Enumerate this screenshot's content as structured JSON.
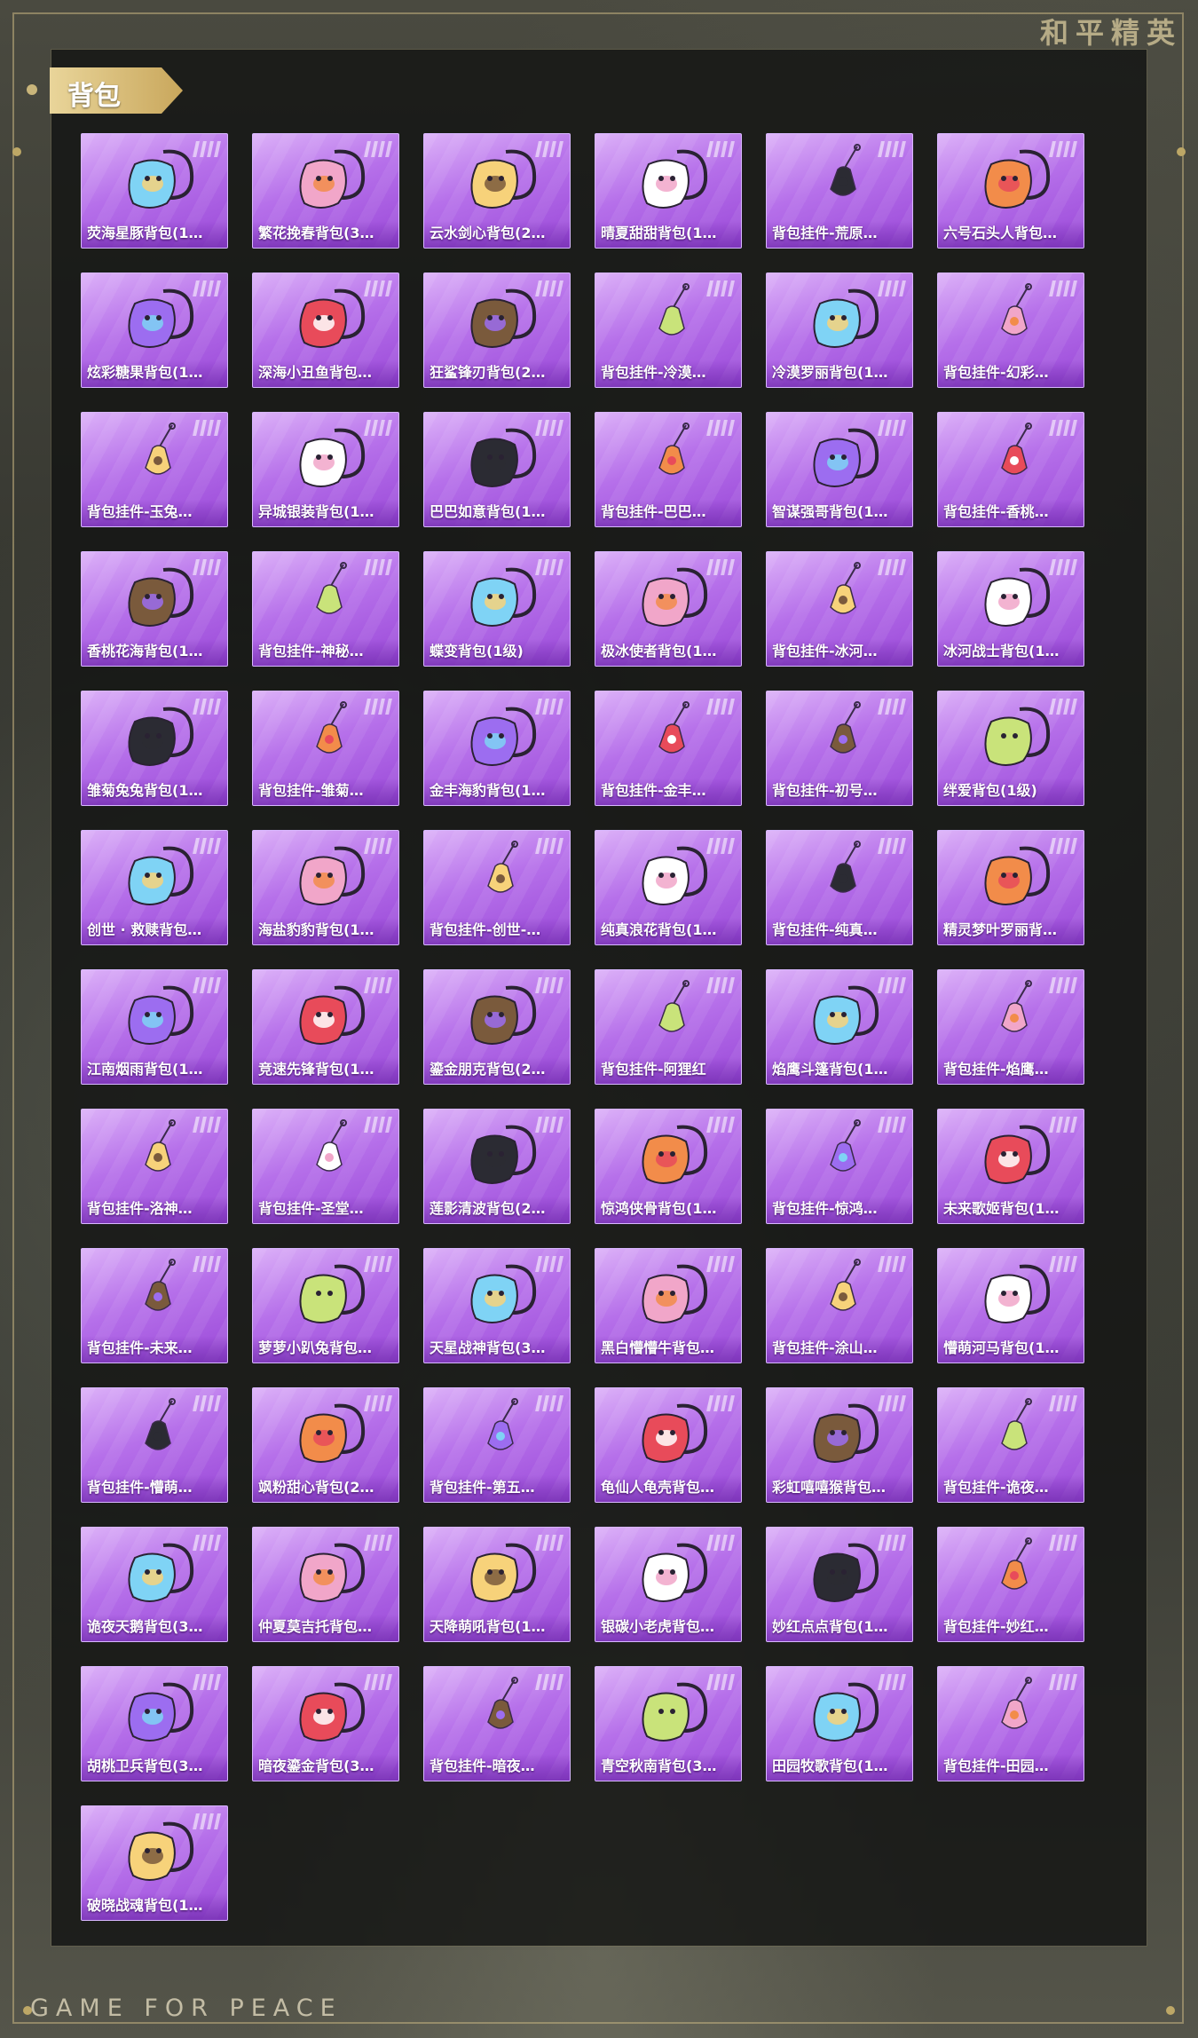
{
  "brand": "和平精英",
  "section_title": "背包",
  "footer": "GAME FOR PEACE",
  "colors": {
    "card_top": "#dcb1f8",
    "card_bottom": "#9a49d8",
    "card_border": "#d8b7ff",
    "tag_gold": "#e9d59a"
  },
  "items": [
    {
      "name": "荧海星豚背包(1…",
      "icon": "dolphin-backpack"
    },
    {
      "name": "繁花挽春背包(3…",
      "icon": "flower-bowl-backpack"
    },
    {
      "name": "云水剑心背包(2…",
      "icon": "sword-backpack"
    },
    {
      "name": "晴夏甜甜背包(1…",
      "icon": "bunny-backpack"
    },
    {
      "name": "背包挂件-荒原…",
      "icon": "star-charm"
    },
    {
      "name": "六号石头人背包…",
      "icon": "stone-golem-backpack"
    },
    {
      "name": "炫彩糖果背包(1…",
      "icon": "donut-backpack"
    },
    {
      "name": "深海小丑鱼背包…",
      "icon": "clownfish-backpack"
    },
    {
      "name": "狂鲨锋刃背包(2…",
      "icon": "shark-backpack"
    },
    {
      "name": "背包挂件-冷漠…",
      "icon": "flower-charm"
    },
    {
      "name": "冷漠罗丽背包(1…",
      "icon": "crown-backpack"
    },
    {
      "name": "背包挂件-幻彩…",
      "icon": "robot-charm"
    },
    {
      "name": "背包挂件-玉兔…",
      "icon": "rabbit-charm"
    },
    {
      "name": "异城银装背包(1…",
      "icon": "tech-backpack"
    },
    {
      "name": "巴巴如意背包(1…",
      "icon": "white-bunny-backpack"
    },
    {
      "name": "背包挂件-巴巴…",
      "icon": "fox-charm"
    },
    {
      "name": "智谋强哥背包(1…",
      "icon": "bear-backpack"
    },
    {
      "name": "背包挂件-香桃…",
      "icon": "peach-blossom-charm"
    },
    {
      "name": "香桃花海背包(1…",
      "icon": "shell-backpack"
    },
    {
      "name": "背包挂件-神秘…",
      "icon": "black-cat-charm"
    },
    {
      "name": "蝶变背包(1级)",
      "icon": "butterfly-backpack"
    },
    {
      "name": "极冰使者背包(1…",
      "icon": "ice-backpack"
    },
    {
      "name": "背包挂件-冰河…",
      "icon": "mech-charm"
    },
    {
      "name": "冰河战士背包(1…",
      "icon": "blue-backpack"
    },
    {
      "name": "雏菊兔兔背包(1…",
      "icon": "daisy-backpack"
    },
    {
      "name": "背包挂件-雏菊…",
      "icon": "bunny-plush-charm"
    },
    {
      "name": "金丰海豹背包(1…",
      "icon": "seal-backpack"
    },
    {
      "name": "背包挂件-金丰…",
      "icon": "banner-charm"
    },
    {
      "name": "背包挂件-初号…",
      "icon": "purple-sword-charm"
    },
    {
      "name": "绊爱背包(1级)",
      "icon": "pink-backpack"
    },
    {
      "name": "创世 · 救赎背包…",
      "icon": "gold-mech-backpack"
    },
    {
      "name": "海盐豹豹背包(1…",
      "icon": "blob-backpack"
    },
    {
      "name": "背包挂件-创世-…",
      "icon": "canister-charm"
    },
    {
      "name": "纯真浪花背包(1…",
      "icon": "bucket-backpack"
    },
    {
      "name": "背包挂件-纯真…",
      "icon": "key-charm"
    },
    {
      "name": "精灵梦叶罗丽背…",
      "icon": "lace-backpack"
    },
    {
      "name": "江南烟雨背包(1…",
      "icon": "fan-backpack"
    },
    {
      "name": "竞速先锋背包(1…",
      "icon": "racer-backpack"
    },
    {
      "name": "鎏金朋克背包(2…",
      "icon": "punk-backpack"
    },
    {
      "name": "背包挂件-阿狸红",
      "icon": "red-fox-charm"
    },
    {
      "name": "焰鹰斗篷背包(1…",
      "icon": "cape-backpack"
    },
    {
      "name": "背包挂件-焰鹰…",
      "icon": "knot-charm"
    },
    {
      "name": "背包挂件-洛神…",
      "icon": "ribbon-charm"
    },
    {
      "name": "背包挂件-圣堂…",
      "icon": "gem-charm"
    },
    {
      "name": "莲影清波背包(2…",
      "icon": "lotus-backpack"
    },
    {
      "name": "惊鸿侠骨背包(1…",
      "icon": "leather-backpack"
    },
    {
      "name": "背包挂件-惊鸿…",
      "icon": "tassel-charm"
    },
    {
      "name": "未来歌姬背包(1…",
      "icon": "idol-backpack"
    },
    {
      "name": "背包挂件-未来…",
      "icon": "heart-wing-charm"
    },
    {
      "name": "萝萝小趴兔背包…",
      "icon": "yellow-bunny-backpack"
    },
    {
      "name": "天星战神背包(3…",
      "icon": "winged-backpack"
    },
    {
      "name": "黑白懵懵牛背包…",
      "icon": "cow-backpack"
    },
    {
      "name": "背包挂件-涂山…",
      "icon": "fox-tail-charm"
    },
    {
      "name": "懵萌河马背包(1…",
      "icon": "hippo-backpack"
    },
    {
      "name": "背包挂件-懵萌…",
      "icon": "leaf-charm"
    },
    {
      "name": "飒粉甜心背包(2…",
      "icon": "pink-cat-backpack"
    },
    {
      "name": "背包挂件-第五…",
      "icon": "pink-heart-charm"
    },
    {
      "name": "龟仙人龟壳背包…",
      "icon": "turtle-shell-backpack"
    },
    {
      "name": "彩虹嘻嘻猴背包…",
      "icon": "monkey-backpack"
    },
    {
      "name": "背包挂件-诡夜…",
      "icon": "doll-charm"
    },
    {
      "name": "诡夜天鹅背包(3…",
      "icon": "ghost-backpack"
    },
    {
      "name": "仲夏莫吉托背包…",
      "icon": "cup-backpack"
    },
    {
      "name": "天降萌吼背包(1…",
      "icon": "orange-backpack"
    },
    {
      "name": "银碳小老虎背包…",
      "icon": "tiger-backpack"
    },
    {
      "name": "妙红点点背包(1…",
      "icon": "red-bottle-backpack"
    },
    {
      "name": "背包挂件-妙红…",
      "icon": "daisy-charm"
    },
    {
      "name": "胡桃卫兵背包(3…",
      "icon": "guard-backpack"
    },
    {
      "name": "暗夜鎏金背包(3…",
      "icon": "dark-gold-backpack"
    },
    {
      "name": "背包挂件-暗夜…",
      "icon": "dark-tassel-charm"
    },
    {
      "name": "青空秋南背包(3…",
      "icon": "navy-backpack"
    },
    {
      "name": "田园牧歌背包(1…",
      "icon": "basket-backpack"
    },
    {
      "name": "背包挂件-田园…",
      "icon": "card-charm"
    },
    {
      "name": "破晓战魂背包(1…",
      "icon": "red-backpack"
    }
  ]
}
